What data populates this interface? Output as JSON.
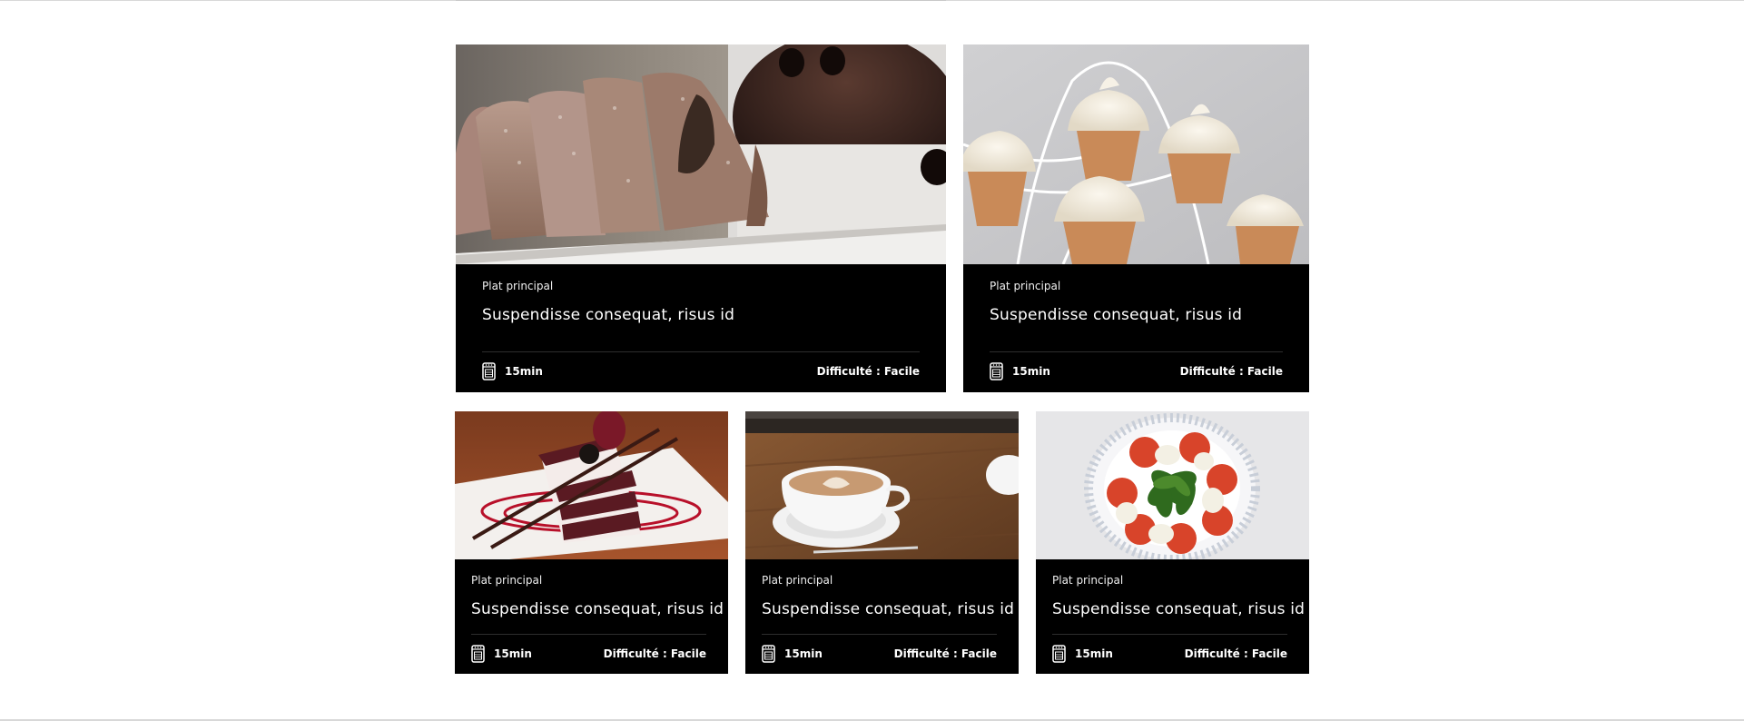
{
  "recipes": [
    {
      "category": "Plat principal",
      "title": "Suspendisse consequat, risus id",
      "time": "15min",
      "difficulty": "Difficulté : Facile",
      "photo": "sliced-cake-photo"
    },
    {
      "category": "Plat principal",
      "title": "Suspendisse consequat, risus id",
      "time": "15min",
      "difficulty": "Difficulté : Facile",
      "photo": "cupcakes-photo"
    },
    {
      "category": "Plat principal",
      "title": "Suspendisse consequat, risus id",
      "time": "15min",
      "difficulty": "Difficulté : Facile",
      "photo": "red-velvet-cake-photo"
    },
    {
      "category": "Plat principal",
      "title": "Suspendisse consequat, risus id",
      "time": "15min",
      "difficulty": "Difficulté : Facile",
      "photo": "coffee-cup-photo"
    },
    {
      "category": "Plat principal",
      "title": "Suspendisse consequat, risus id",
      "time": "15min",
      "difficulty": "Difficulté : Facile",
      "photo": "caprese-salad-photo"
    }
  ],
  "icons": {
    "time": "oven-icon"
  },
  "colors": {
    "card_background": "#000000",
    "card_text": "#ffffff",
    "page_background": "#ffffff"
  }
}
